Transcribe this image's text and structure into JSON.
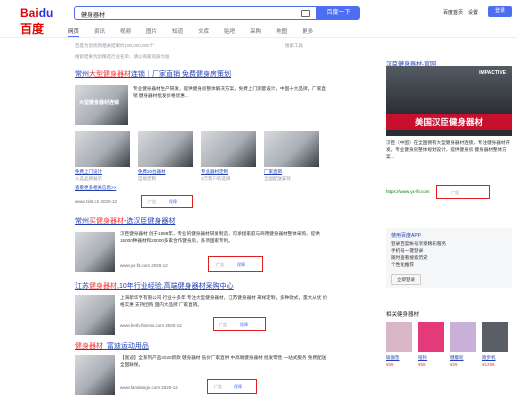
{
  "header": {
    "logo_left": "Bai",
    "logo_paw": "du",
    "logo_right": "百度",
    "query": "健身器材",
    "search_button": "百度一下",
    "homepage": "百度首页",
    "settings": "设置",
    "login": "登录"
  },
  "tabs": [
    "网页",
    "资讯",
    "视频",
    "图片",
    "知道",
    "文库",
    "贴吧",
    "采购",
    "地图",
    "更多"
  ],
  "result_count": "百度为您找到相关结果约100,000,000个",
  "search_tools": "搜索工具",
  "notice": "搜索结果为您精选行业名单，请以商家资质为准",
  "results": [
    {
      "title_prefix": "常州",
      "title_em": "大型健身器材",
      "title_rest": "连锁｜厂家直销 免费健身房策划",
      "desc": "专业健身器材生产研发，提供健身房整体解决方案，免费上门测量设计，中国十大品牌。厂家直销 健身器材批发价格优惠...",
      "img_caption": "大型健身器材连锁",
      "thumbs": [
        {
          "label": "免费上门设计",
          "sub": "入选品牌展示"
        },
        {
          "label": "免费20台器材",
          "sub": "自助定制"
        },
        {
          "label": "专业器材定制",
          "sub": "3万客户的选择"
        },
        {
          "label": "厂家直销",
          "sub": "全国配送安装"
        }
      ],
      "links": "查看更多相关信息>>",
      "url": "www.rxbt.cn 2020-12",
      "ad": "广告",
      "badge": "保障"
    },
    {
      "title_prefix": "常州",
      "title_em": "买健身器材",
      "title_rest": "-选汉臣健身器材",
      "desc": "汉臣健身器材 创于1998年，专业的健身器材研发制造，可承接家庭与商用健身器材整体采购，提供15000种器材和20000多家合作健身房，多项国家专利。",
      "url": "www.yx-fit.com 2020-12",
      "ad": "广告",
      "badge": "保障"
    },
    {
      "title_prefix": "江苏",
      "title_em": "健身器材",
      "title_rest": ",10年行业经验,高端健身器材采购中心",
      "desc": "上海新华亨有限公司 行业十多年 专注大型健身器材，江苏健身器材 来样定制，多种款式，量大从优 价格实惠 支持团购 国内大品牌 厂家直销。",
      "url": "www.herb-fitness.com 2020-12",
      "ad": "广告",
      "badge": "保障"
    },
    {
      "title_prefix": "",
      "title_em": "健身器材",
      "title_rest": "_富迪运动用品",
      "desc": "【富迪】全系列产品2020新款 健身器材 低价厂家直供 中高端健身器材 批发零售 一站式服务 免费配送 全国联保。",
      "url": "www.fandesign.com 2020-12",
      "ad": "广告",
      "badge": "保障"
    }
  ],
  "sidebar": {
    "title": "汉臣健身器材-官网",
    "banner": "美国汉臣健身器材",
    "banner_brand": "IMPACTIVE",
    "desc": "汉臣（中国）在全国拥有大型健身器材连锁，专注健身器材开发，专业健身房整体规划设计，提供健身房 健身器材整体方案...",
    "url": "https://www.yx-fit.com",
    "ad": "广告",
    "promo_title": "使用百度APP",
    "promo_lines": [
      "登录百度帐号享受精彩服务",
      "手机号一键登录",
      "随时查看搜索历史",
      "个性化推荐"
    ],
    "login_btn": "立即登录",
    "related_title": "相关健身器材",
    "products": [
      {
        "name": "瑜伽垫",
        "price": "¥39"
      },
      {
        "name": "哑铃",
        "price": "¥59"
      },
      {
        "name": "健腹轮",
        "price": "¥29"
      },
      {
        "name": "跑步机",
        "price": "¥1299"
      }
    ]
  },
  "colors": {
    "brand": "#4e6ef2",
    "link": "#2440b3",
    "highlight": "#f73131",
    "redbox": "#e02020"
  }
}
